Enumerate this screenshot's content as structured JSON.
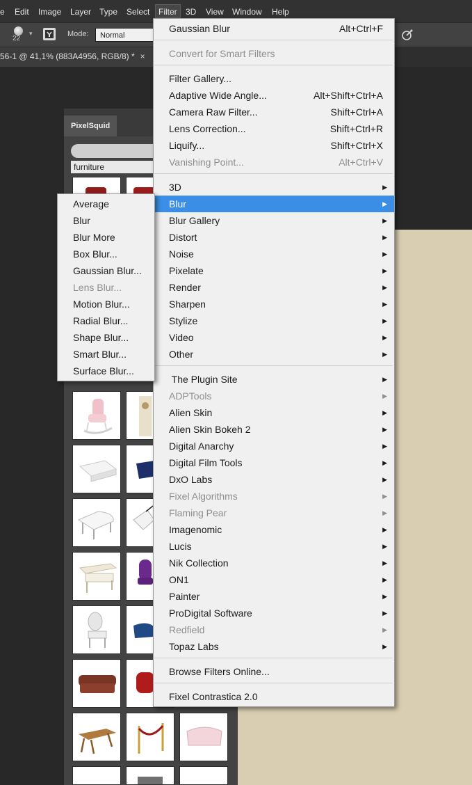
{
  "menubar": {
    "items": [
      "e",
      "Edit",
      "Image",
      "Layer",
      "Type",
      "Select",
      "Filter",
      "3D",
      "View",
      "Window",
      "Help"
    ]
  },
  "options_bar": {
    "brush_size": "22",
    "mode_label": "Mode:",
    "mode_value": "Normal"
  },
  "document_tab": {
    "title": "56-1 @ 41,1% (883A4956, RGB/8) *",
    "close": "×"
  },
  "pixelsquid": {
    "tab_label": "PixelSquid",
    "category": "furniture"
  },
  "filter_menu": {
    "items": [
      {
        "label": "Gaussian Blur",
        "shortcut": "Alt+Ctrl+F"
      },
      {
        "label": "Convert for Smart Filters",
        "disabled": true
      },
      {
        "label": "Filter Gallery..."
      },
      {
        "label": "Adaptive Wide Angle...",
        "shortcut": "Alt+Shift+Ctrl+A"
      },
      {
        "label": "Camera Raw Filter...",
        "shortcut": "Shift+Ctrl+A"
      },
      {
        "label": "Lens Correction...",
        "shortcut": "Shift+Ctrl+R"
      },
      {
        "label": "Liquify...",
        "shortcut": "Shift+Ctrl+X"
      },
      {
        "label": "Vanishing Point...",
        "shortcut": "Alt+Ctrl+V",
        "disabled": true
      },
      {
        "label": "3D",
        "submenu": true
      },
      {
        "label": "Blur",
        "submenu": true,
        "highlighted": true
      },
      {
        "label": "Blur Gallery",
        "submenu": true
      },
      {
        "label": "Distort",
        "submenu": true
      },
      {
        "label": "Noise",
        "submenu": true
      },
      {
        "label": "Pixelate",
        "submenu": true
      },
      {
        "label": "Render",
        "submenu": true
      },
      {
        "label": "Sharpen",
        "submenu": true
      },
      {
        "label": "Stylize",
        "submenu": true
      },
      {
        "label": "Video",
        "submenu": true
      },
      {
        "label": "Other",
        "submenu": true
      },
      {
        "label": " The Plugin Site",
        "submenu": true
      },
      {
        "label": "ADPTools",
        "submenu": true,
        "disabled": true
      },
      {
        "label": "Alien Skin",
        "submenu": true
      },
      {
        "label": "Alien Skin Bokeh 2",
        "submenu": true
      },
      {
        "label": "Digital Anarchy",
        "submenu": true
      },
      {
        "label": "Digital Film Tools",
        "submenu": true
      },
      {
        "label": "DxO Labs",
        "submenu": true
      },
      {
        "label": "Fixel Algorithms",
        "submenu": true,
        "disabled": true
      },
      {
        "label": "Flaming Pear",
        "submenu": true,
        "disabled": true
      },
      {
        "label": "Imagenomic",
        "submenu": true
      },
      {
        "label": "Lucis",
        "submenu": true
      },
      {
        "label": "Nik Collection",
        "submenu": true
      },
      {
        "label": "ON1",
        "submenu": true
      },
      {
        "label": "Painter",
        "submenu": true
      },
      {
        "label": "ProDigital Software",
        "submenu": true
      },
      {
        "label": "Redfield",
        "submenu": true,
        "disabled": true
      },
      {
        "label": "Topaz Labs",
        "submenu": true
      },
      {
        "label": "Browse Filters Online..."
      },
      {
        "label": "Fixel Contrastica 2.0"
      }
    ]
  },
  "blur_submenu": {
    "items": [
      {
        "label": "Average"
      },
      {
        "label": "Blur"
      },
      {
        "label": "Blur More"
      },
      {
        "label": "Box Blur..."
      },
      {
        "label": "Gaussian Blur..."
      },
      {
        "label": "Lens Blur...",
        "disabled": true
      },
      {
        "label": "Motion Blur..."
      },
      {
        "label": "Radial Blur..."
      },
      {
        "label": "Shape Blur..."
      },
      {
        "label": "Smart Blur..."
      },
      {
        "label": "Surface Blur..."
      }
    ]
  },
  "icons": {
    "submenu_arrow": "▶",
    "mode_caret": "▾"
  },
  "colors": {
    "menu_highlight": "#3a8ee6",
    "canvas": "#d9cdb2"
  }
}
